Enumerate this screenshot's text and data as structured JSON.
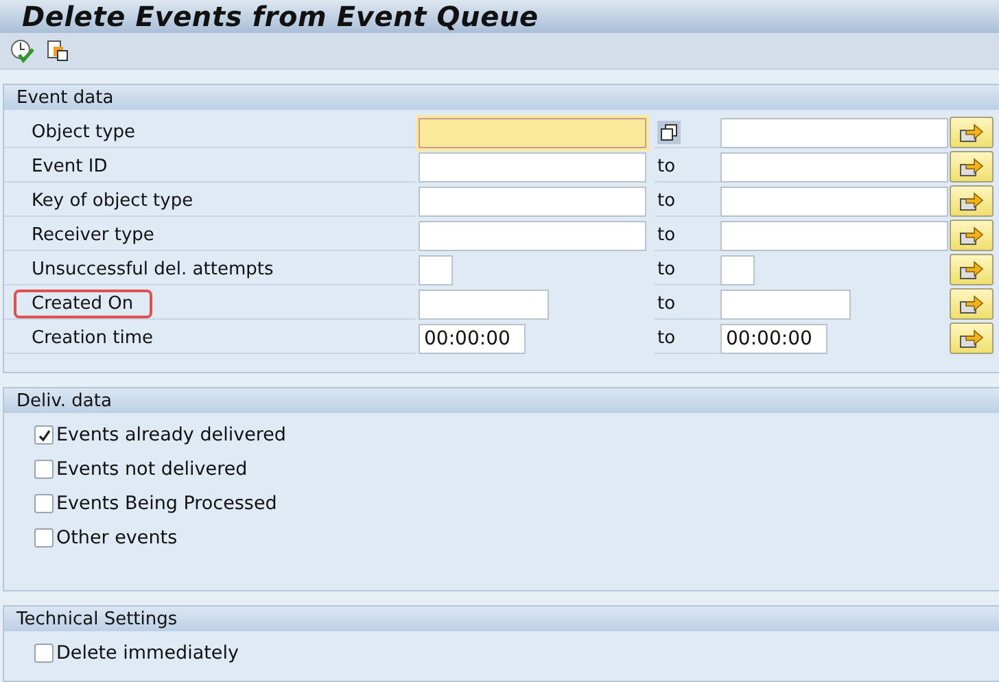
{
  "title": "Delete Events from Event Queue",
  "event_data": {
    "title": "Event data",
    "rows": [
      {
        "label": "Object type",
        "kind": "long",
        "focused": true,
        "highlighted": false
      },
      {
        "label": "Event ID",
        "kind": "long",
        "to": "to",
        "focused": false,
        "highlighted": false
      },
      {
        "label": "Key of object type",
        "kind": "long",
        "to": "to",
        "focused": false,
        "highlighted": false
      },
      {
        "label": "Receiver type",
        "kind": "long",
        "to": "to",
        "focused": false,
        "highlighted": false
      },
      {
        "label": "Unsuccessful del. attempts",
        "kind": "short",
        "to": "to",
        "focused": false,
        "highlighted": false
      },
      {
        "label": "Created On",
        "kind": "medium",
        "to": "to",
        "focused": false,
        "highlighted": true
      },
      {
        "label": "Creation time",
        "kind": "time",
        "to": "to",
        "low_value": "00:00:00",
        "high_value": "00:00:00",
        "focused": false,
        "highlighted": false
      }
    ]
  },
  "deliv_data": {
    "title": "Deliv. data",
    "options": [
      {
        "label": "Events already delivered",
        "checked": true
      },
      {
        "label": "Events not delivered",
        "checked": false
      },
      {
        "label": "Events Being Processed",
        "checked": false
      },
      {
        "label": "Other events",
        "checked": false
      }
    ]
  },
  "technical_settings": {
    "title": "Technical Settings",
    "options": [
      {
        "label": "Delete immediately",
        "checked": false
      }
    ]
  }
}
